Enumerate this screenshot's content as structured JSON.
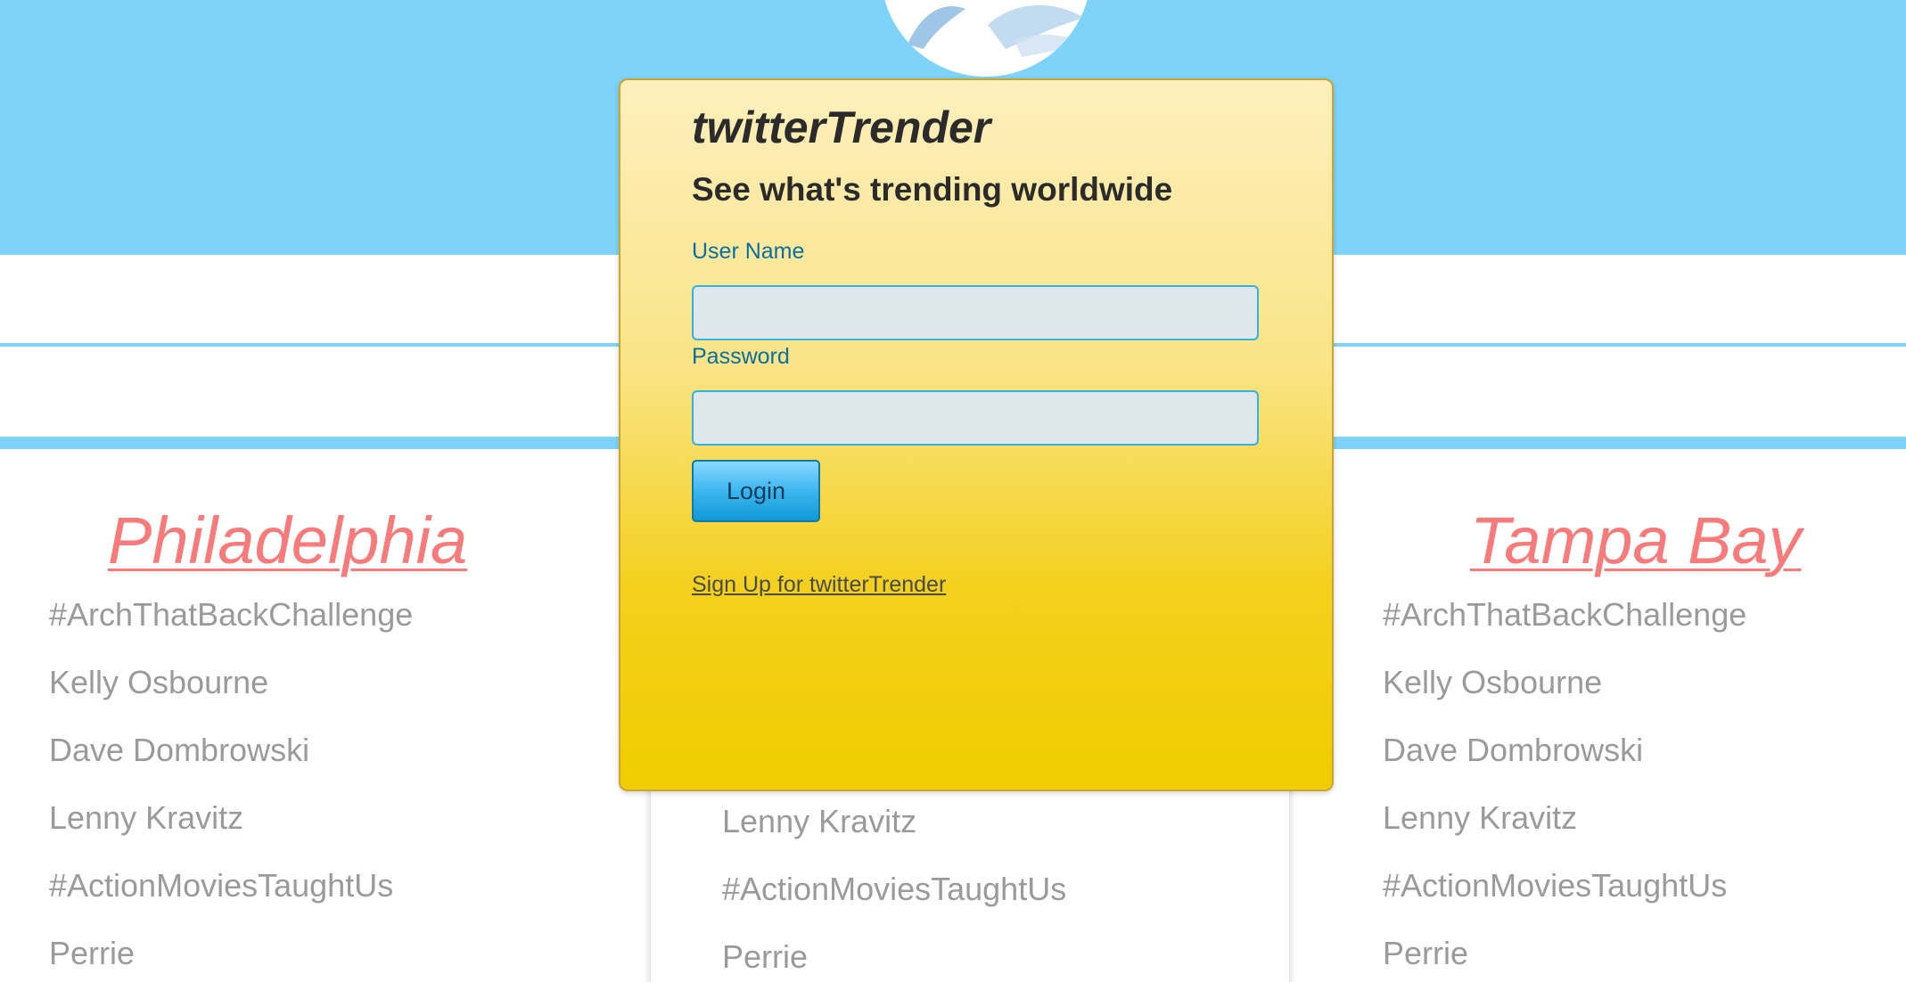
{
  "app": {
    "brand": "twitterTrender",
    "tagline": "See what's trending worldwide"
  },
  "login": {
    "username_label": "User Name",
    "username_value": "",
    "password_label": "Password",
    "password_value": "",
    "login_button": "Login",
    "signup_link": "Sign Up for twitterTrender"
  },
  "columns": {
    "left": {
      "city": "Philadelphia",
      "trends": [
        "#ArchThatBackChallenge",
        "Kelly Osbourne",
        "Dave Dombrowski",
        "Lenny Kravitz",
        "#ActionMoviesTaughtUs",
        "Perrie"
      ]
    },
    "center": {
      "trends": [
        "Lenny Kravitz",
        "#ActionMoviesTaughtUs",
        "Perrie"
      ]
    },
    "right": {
      "city": "Tampa Bay",
      "trends": [
        "#ArchThatBackChallenge",
        "Kelly Osbourne",
        "Dave Dombrowski",
        "Lenny Kravitz",
        "#ActionMoviesTaughtUs",
        "Perrie"
      ]
    }
  },
  "colors": {
    "sky_blue": "#7dd4f8",
    "city_link": "#f77b7b",
    "trend_text": "#9a9a9a",
    "card_yellow": "#f0cd00",
    "label_blue": "#0b6f9e"
  },
  "icons": [
    "bird-logo-icon"
  ]
}
